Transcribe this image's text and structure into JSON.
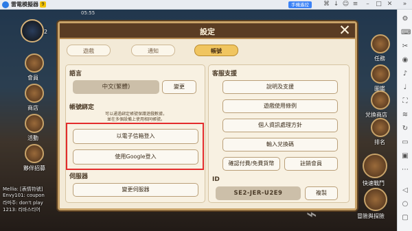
{
  "emulator": {
    "title": "雷電模擬器",
    "version": "9",
    "control_label": "手機遙控",
    "top_icons": [
      "gamepad-icon",
      "download-icon",
      "user-icon",
      "menu-icon",
      "minimize-icon",
      "restore-icon",
      "close-icon",
      "sidebar-toggle-icon"
    ],
    "right_icons": [
      "settings-icon",
      "keyboard-icon",
      "screenshot-icon",
      "record-icon",
      "volume-up-icon",
      "volume-down-icon",
      "fullscreen-icon",
      "shake-icon",
      "rotate-icon",
      "folder-icon",
      "multi-window-icon",
      "more-icon",
      "back-icon",
      "home-icon",
      "recent-icon"
    ]
  },
  "game_hud": {
    "time": "05:55",
    "level": "2",
    "left_labels": [
      "會員",
      "商店",
      "活動",
      "夥伴招募"
    ],
    "right_labels": [
      "任務",
      "圖鑑",
      "兌換商店",
      "排名",
      "快速戰鬥",
      "冒險與探險"
    ],
    "chat_lines": [
      "Mellia: [表情符號]",
      "Envy101: coupon",
      "라마주: don't play",
      "1213: 리바스티어"
    ]
  },
  "dialog": {
    "title": "設定",
    "close_icon": "✕",
    "tabs": [
      {
        "label": "遊戲",
        "active": false
      },
      {
        "label": "通知",
        "active": false
      },
      {
        "label": "帳號",
        "active": true
      }
    ],
    "language": {
      "section_title": "語言",
      "current": "中文(繁體)",
      "change_button": "變更"
    },
    "account_binding": {
      "section_title": "帳號綁定",
      "note_line1": "可以通過綁定帳號保護遊戲數據，",
      "note_line2": "並在多個設備上使用相同帳號。",
      "email_login": "以電子信箱登入",
      "google_login": "使用Google登入"
    },
    "server": {
      "section_title": "伺服器",
      "change_button": "變更伺服器"
    },
    "support": {
      "section_title": "客服支援",
      "buttons": [
        "說明及支援",
        "遊戲使用條例",
        "個人資訊處理方針",
        "輸入兌換碼"
      ],
      "payment_history": "確認付費/免費貨幣",
      "cancel_membership": "註銷會員"
    },
    "id": {
      "section_title": "ID",
      "value": "SE2-JER-U2E9",
      "copy_button": "複製"
    }
  },
  "colors": {
    "highlight": "#e32b2b",
    "header_brown": "#5a3c23",
    "tab_active": "#f0c560"
  }
}
